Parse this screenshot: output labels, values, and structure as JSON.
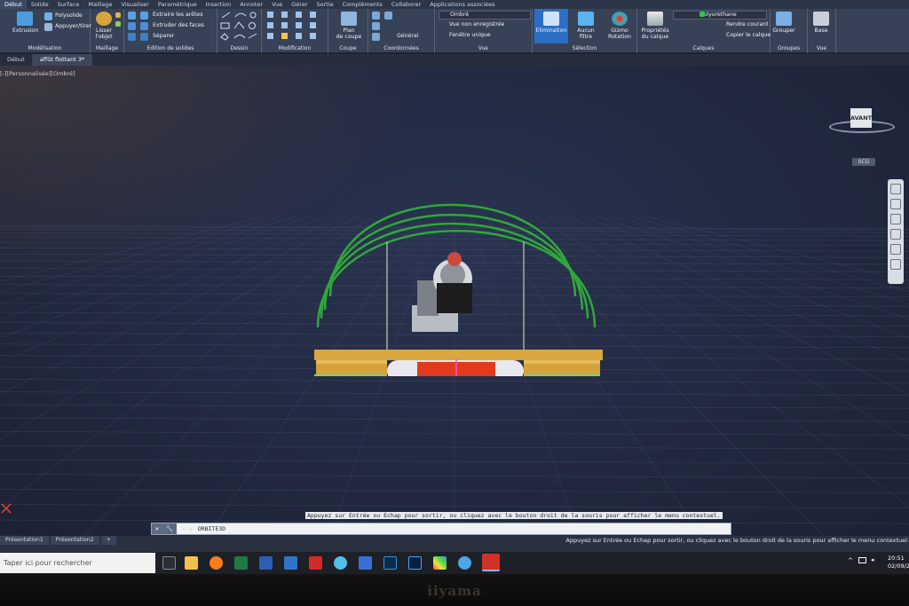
{
  "menubar": {
    "tabs": [
      "Début",
      "Solide",
      "Surface",
      "Maillage",
      "Visualiser",
      "Paramétrique",
      "Insertion",
      "Annoter",
      "Vue",
      "Gérer",
      "Sortie",
      "Compléments",
      "Collaborer",
      "Applications associées"
    ]
  },
  "ribbon": {
    "modelisation": {
      "label": "Modélisation",
      "extrusion": "Extrusion",
      "polysolide": "Polysolide",
      "appuyer_tirer": "Appuyer/tirer"
    },
    "maillage": {
      "label": "Maillage",
      "lisser": "Lisser",
      "lobjet": "l'objet"
    },
    "edition_solides": {
      "label": "Edition de solides",
      "extraire_aretes": "Extraire les arêtes",
      "extruder_faces": "Extruder des faces",
      "separer": "Séparer"
    },
    "dessin": {
      "label": "Dessin"
    },
    "modification": {
      "label": "Modification"
    },
    "coupe": {
      "label": "Coupe",
      "plan": "Plan",
      "de_coupe": "de coupe"
    },
    "coordonnees": {
      "label": "Coordonnées",
      "general": "Général"
    },
    "vue": {
      "label": "Vue",
      "style": "Ombré",
      "vue_non_enreg": "Vue non enregistrée",
      "fenetre_unique": "Fenêtre unique"
    },
    "selection": {
      "label": "Sélection",
      "elimination": "Elimination",
      "aucun_filtre": "Aucun filtre",
      "gizmo": "Gizmo",
      "rotation": "Rotation"
    },
    "calques": {
      "label": "Calques",
      "proprietes": "Propriétés",
      "du_calque": "du calque",
      "calque_courant": "Polyurethane",
      "rendre_courant": "Rendre courant",
      "copier_calque": "Copier le calque"
    },
    "groupes": {
      "label": "Groupes",
      "grouper": "Grouper"
    },
    "vue2": {
      "label": "Vue",
      "base": "Base"
    }
  },
  "doctabs": [
    "Début",
    "affût flottant 3*"
  ],
  "viewport": {
    "label": "[-][Personnalisée][Ombré]",
    "viewcube_face": "AVANT",
    "wcs_label": "SCG"
  },
  "tooltip": "Appuyez sur Entrée ou Echap pour sortir, ou cliquez avec le bouton droit de la souris pour afficher le menu contextuel.",
  "cmdline": {
    "prompt": "- -",
    "text": "ORBITE3D"
  },
  "layouttabs": [
    "Présentation1",
    "Présentation2",
    "+"
  ],
  "status_hint": "Appuyez sur Entrée ou Echap pour sortir, ou cliquez avec le bouton droit de la souris pour afficher le menu contextuel.",
  "taskbar": {
    "search_placeholder": "Taper ici pour rechercher",
    "time": "20:51",
    "date": "02/09/2"
  },
  "monitor_brand": "iiyama",
  "colors": {
    "ribbon": "#384257",
    "viewport": "#232b42",
    "accent_active": "#2b6fc4",
    "arch_green": "#2fa83a",
    "plank": "#d9a640",
    "float_red": "#e23a1e"
  }
}
